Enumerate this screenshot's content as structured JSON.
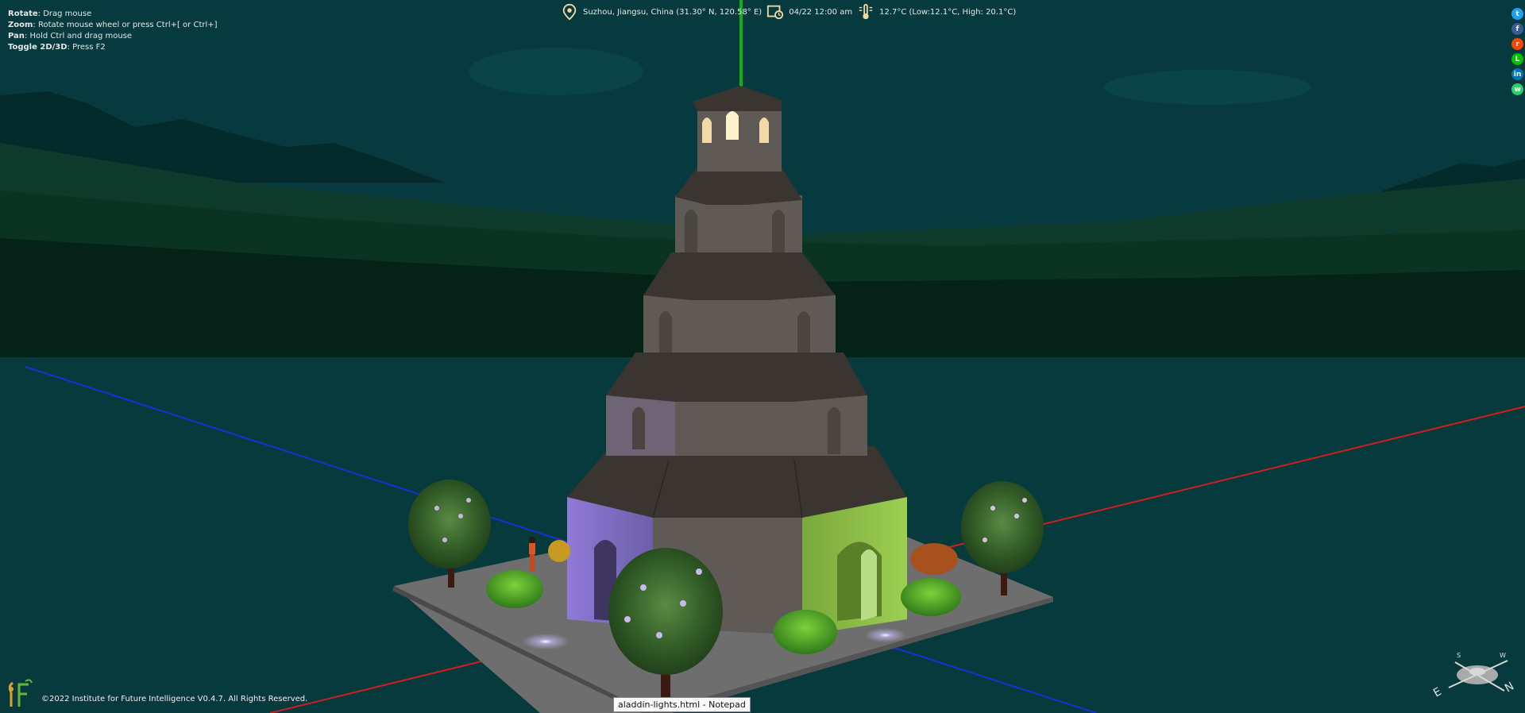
{
  "help": {
    "rotate": {
      "key": "Rotate",
      "value": ": Drag mouse"
    },
    "zoom": {
      "key": "Zoom",
      "value": ": Rotate mouse wheel or press Ctrl+[ or Ctrl+]"
    },
    "pan": {
      "key": "Pan",
      "value": ": Hold Ctrl and drag mouse"
    },
    "toggle": {
      "key": "Toggle 2D/3D",
      "value": ": Press F2"
    }
  },
  "status": {
    "location": "Suzhou, Jiangsu, China (31.30° N, 120.58° E)",
    "datetime": "04/22 12:00 am",
    "weather": "12.7°C (Low:12.1°C, High: 20.1°C)"
  },
  "share": [
    {
      "icon": "twitter-icon",
      "glyph": "t",
      "color": "#1da1f2"
    },
    {
      "icon": "facebook-icon",
      "glyph": "f",
      "color": "#3b5998"
    },
    {
      "icon": "reddit-icon",
      "glyph": "r",
      "color": "#ff4500"
    },
    {
      "icon": "line-icon",
      "glyph": "L",
      "color": "#00c300"
    },
    {
      "icon": "linkedin-icon",
      "glyph": "in",
      "color": "#0077b5"
    },
    {
      "icon": "whatsapp-icon",
      "glyph": "w",
      "color": "#25d366"
    }
  ],
  "footer": {
    "copyright": "©2022 Institute for Future Intelligence V0.4.7. All Rights Reserved."
  },
  "tooltip": "aladdin-lights.html - Notepad",
  "compass": {
    "n": "N",
    "e": "E",
    "w": "W",
    "s": "S"
  },
  "colors": {
    "sky": "#063a3e",
    "ground": "#073a3d",
    "hills": "#0c3a26",
    "roof": "#3a3530",
    "wall": "#5f5a55",
    "purple_light": "#8a78d4",
    "green_light": "#8fc048",
    "x_axis": "#d11e1e",
    "y_axis": "#1a2ed8",
    "z_axis": "#12b012"
  }
}
